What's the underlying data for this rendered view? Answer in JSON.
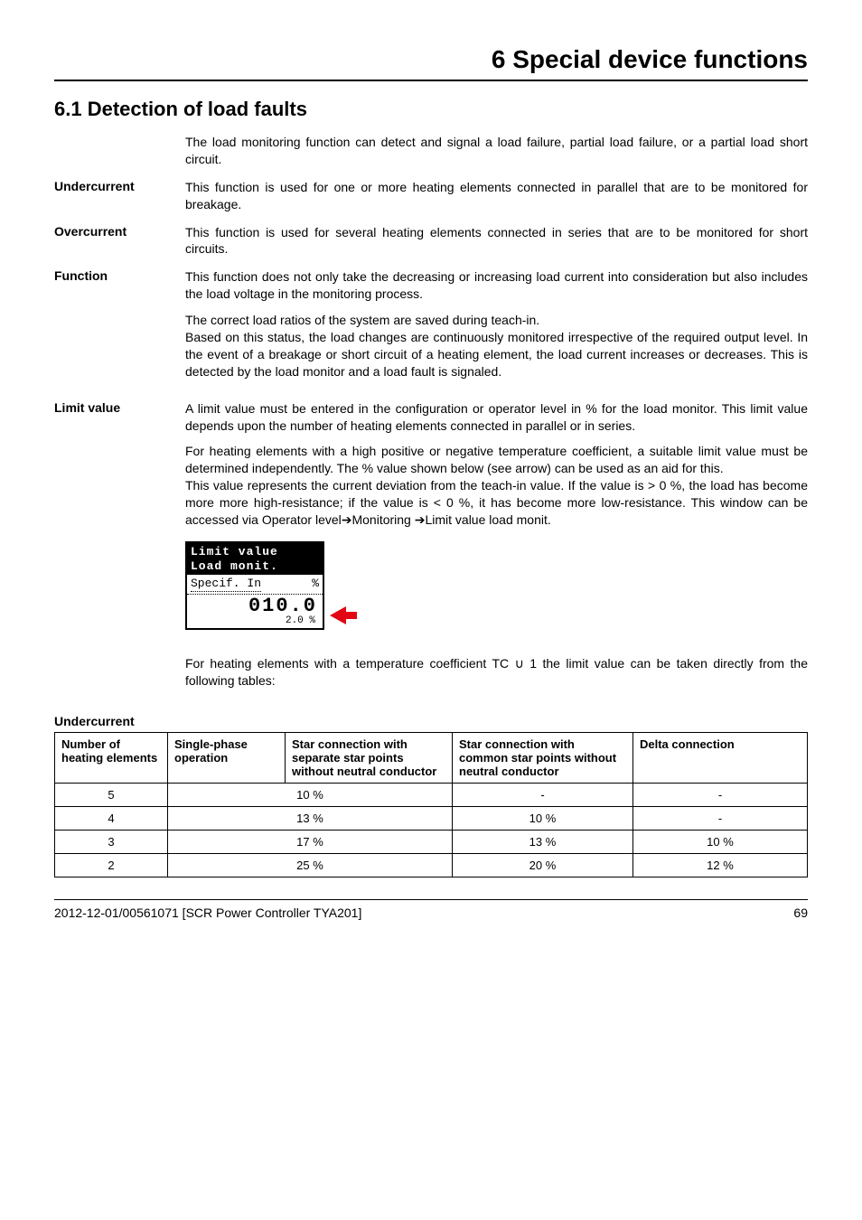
{
  "chapter": "6 Special device functions",
  "section": "6.1  Detection of load faults",
  "intro": "The load monitoring function can detect and signal a load failure, partial load failure, or a partial load short circuit.",
  "undercurrent": {
    "label": "Undercurrent",
    "text": "This function is used for one or more heating elements connected in parallel that are to be monitored for breakage."
  },
  "overcurrent": {
    "label": "Overcurrent",
    "text": "This function is used for several heating elements connected in series that are to be monitored for short circuits."
  },
  "function": {
    "label": "Function",
    "p1": "This function does not only take the decreasing or increasing load current into consideration but also includes the load voltage in the monitoring process.",
    "p2": "The correct load ratios of the system are saved during teach-in.\nBased on this status, the load changes are continuously monitored irrespective of the required output level. In the event of a breakage or short circuit of a heating element, the load current increases or decreases. This is detected by the load monitor and a load fault is signaled."
  },
  "limit": {
    "label": "Limit value",
    "p1": "A limit value must be entered in the configuration or operator level in % for the load monitor. This limit value depends upon the number of heating elements connected in parallel or in series.",
    "p2": "For heating elements with a high positive or negative temperature coefficient, a suitable limit value must be determined independently. The % value shown below (see arrow) can be used as an aid for this.\nThis value represents the current deviation from the teach-in value. If the value is > 0 %, the load has become more more high-resistance; if the value is < 0 %, it has become more low-resistance. This window can be accessed via Operator level➔Monitoring ➔Limit value load monit."
  },
  "lcd": {
    "line1": "Limit value",
    "line2": "Load monit.",
    "specif": "Specif. In",
    "unit": "%",
    "value": "010.0",
    "sub": "2.0  %"
  },
  "after_lcd": "For heating elements with a temperature coefficient TC ∪ 1 the limit value can be taken directly from the following tables:",
  "table_heading": "Undercurrent",
  "table": {
    "headers": [
      "Number of heating elements",
      "Single-phase operation",
      "Star connection with separate star points without neutral conductor",
      "Star connection with common star points without neutral conductor",
      "Delta connection"
    ],
    "rows": [
      {
        "n": "5",
        "a": "10 %",
        "b": "-",
        "c": "-"
      },
      {
        "n": "4",
        "a": "13 %",
        "b": "10 %",
        "c": "-"
      },
      {
        "n": "3",
        "a": "17 %",
        "b": "13 %",
        "c": "10 %"
      },
      {
        "n": "2",
        "a": "25 %",
        "b": "20 %",
        "c": "12 %"
      }
    ]
  },
  "footer": {
    "left": "2012-12-01/00561071 [SCR Power Controller TYA201]",
    "right": "69"
  }
}
